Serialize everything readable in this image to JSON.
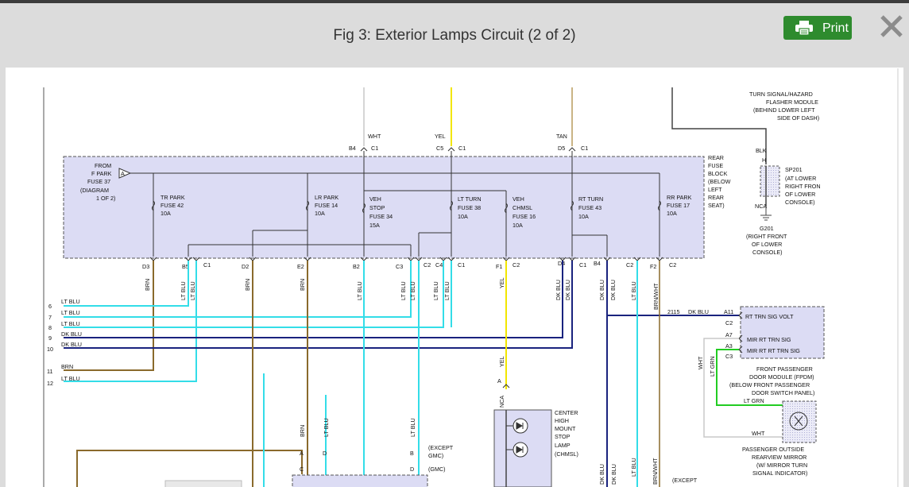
{
  "dialog": {
    "title": "Fig 3: Exterior Lamps Circuit (2 of 2)",
    "print_label": "Print"
  },
  "icons": {
    "print": "printer-icon",
    "close": "close-icon"
  },
  "colors": {
    "print_button": "#2e8b2e",
    "fuse_block": "#dcdcf4",
    "lt_blu": "#33dde8",
    "dk_blu": "#1a237e",
    "yel": "#f2e600",
    "brn": "#8a6a2c",
    "lt_grn": "#22cc22"
  },
  "labels": {
    "wht_top": "WHT",
    "yel_top": "YEL",
    "tan_top": "TAN",
    "b4_c1": "B4",
    "c1_a": "C1",
    "c5_c1": "C5",
    "c1_b": "C1",
    "d5_c1": "D5",
    "c1_c": "C1",
    "from1": "FROM",
    "from2": "F PARK",
    "from3": "FUSE 37",
    "from4": "(DIAGRAM",
    "from5": "1 OF 2)",
    "conn_a": "A",
    "rfb1": "REAR",
    "rfb2": "FUSE",
    "rfb3": "BLOCK",
    "rfb4": "(BELOW",
    "rfb5": "LEFT",
    "rfb6": "REAR",
    "rfb7": "SEAT)",
    "trpark1": "TR PARK",
    "trpark2": "FUSE 42",
    "trpark3": "10A",
    "lrpark1": "LR PARK",
    "lrpark2": "FUSE 14",
    "lrpark3": "10A",
    "veh1": "VEH",
    "veh2": "STOP",
    "veh3": "FUSE 34",
    "veh4": "15A",
    "ltturn1": "LT TURN",
    "ltturn2": "FUSE 38",
    "ltturn3": "10A",
    "chmsl1": "VEH",
    "chmsl2": "CHMSL",
    "chmsl3": "FUSE 16",
    "chmsl4": "10A",
    "rtturn1": "RT TURN",
    "rtturn2": "FUSE 43",
    "rtturn3": "10A",
    "rrpark1": "RR PARK",
    "rrpark2": "FUSE 17",
    "rrpark3": "10A",
    "bot_d3": "D3",
    "bot_b5": "B5",
    "bot_c1a": "C1",
    "bot_d2": "D2",
    "bot_e2": "E2",
    "bot_b2": "B2",
    "bot_c3": "C3",
    "bot_c2a": "C2",
    "bot_c4": "C4",
    "bot_c1b": "C1",
    "bot_f1": "F1",
    "bot_c2b": "C2",
    "bot_d4": "D4",
    "bot_c1c": "C1",
    "bot_b4": "B4",
    "bot_c2c": "C2",
    "bot_f2": "F2",
    "bot_c2d": "C2",
    "w_brn1": "BRN",
    "w_ltblu1": "LT BLU",
    "w_ltblu2": "LT BLU",
    "w_brn2": "BRN",
    "w_brn3": "BRN",
    "w_ltblu3": "LT BLU",
    "w_ltblu4": "LT BLU",
    "w_ltblu5": "LT BLU",
    "w_ltblu6": "LT BLU",
    "w_ltblu7": "LT BLU",
    "w_yel": "YEL",
    "w_dkblu1": "DK BLU",
    "w_dkblu2": "DK BLU",
    "w_dkblu3": "DK BLU",
    "w_dkblu4": "DK BLU",
    "w_ltblu8": "LT BLU",
    "w_brnwht": "BRN/WHT",
    "n6": "6",
    "n7": "7",
    "n8": "8",
    "n9": "9",
    "n10": "10",
    "n11": "11",
    "n12": "12",
    "l6": "LT BLU",
    "l7": "LT BLU",
    "l8": "LT BLU",
    "l9": "DK BLU",
    "l10": "DK BLU",
    "l11": "BRN",
    "l12": "LT BLU",
    "tsh1": "TURN SIGNAL/HAZARD",
    "tsh2": "FLASHER MODULE",
    "tsh3": "(BEHIND LOWER LEFT",
    "tsh4": "SIDE OF DASH)",
    "blk": "BLK",
    "h": "H",
    "sp1": "SP201",
    "sp2": "(AT LOWER",
    "sp3": "RIGHT FRON",
    "sp4": "OF LOWER",
    "sp5": "CONSOLE)",
    "nca1": "NCA",
    "g1": "G201",
    "g2": "(RIGHT FRONT",
    "g3": "OF LOWER",
    "g4": "CONSOLE)",
    "circ": "2115",
    "circ_col": "DK BLU",
    "a11": "A11",
    "c2r": "C2",
    "a7": "A7",
    "a3": "A3",
    "c3r": "C3",
    "m1": "RT TRN SIG VOLT",
    "m2": "MIR RT TRN SIG",
    "m3": "MIR RT RT TRN SIG",
    "fp1": "FRONT PASSENGER",
    "fp2": "DOOR MODULE (FPDM)",
    "fp3": "(BELOW FRONT PASSENGER",
    "fp4": "DOOR SWITCH PANEL)",
    "wht_v": "WHT",
    "ltgrn_v": "LT GRN",
    "ltgrn_h": "LT GRN",
    "wht_h": "WHT",
    "pm1": "PASSENGER OUTSIDE",
    "pm2": "REARVIEW MIRROR",
    "pm3": "(W/ MIRROR TURN",
    "pm4": "SIGNAL INDICATOR)",
    "yel_lower": "YEL",
    "a_conn": "A",
    "nca2": "NCA",
    "chm1": "CENTER",
    "chm2": "HIGH",
    "chm3": "MOUNT",
    "chm4": "STOP",
    "chm5": "LAMP",
    "chm6": "(CHMSL)",
    "lw_brn": "BRN",
    "lw_ltblu1": "LT BLU",
    "lw_ltblu2": "LT BLU",
    "lA": "A",
    "lD1": "D",
    "lB": "B",
    "lC": "C",
    "lD2": "D",
    "exc1": "(EXCEPT",
    "exc2": "GMC)",
    "gmc": "(GMC)",
    "r_dkblu1": "DK BLU",
    "r_dkblu2": "DK BLU",
    "r_ltblu": "LT BLU",
    "r_brnwht": "BRN/WHT",
    "exc3": "(EXCEPT"
  }
}
